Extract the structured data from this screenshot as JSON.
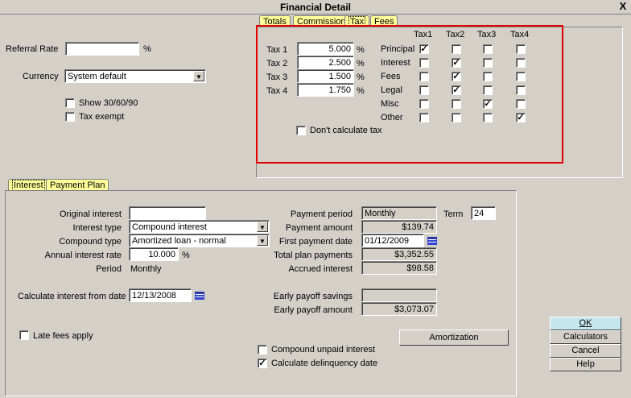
{
  "window": {
    "title": "Financial Detail",
    "close_label": "X"
  },
  "top_tabs": [
    "Totals",
    "Commission",
    "Tax",
    "Fees"
  ],
  "left": {
    "referral_rate_label": "Referral Rate",
    "referral_rate_value": "",
    "referral_rate_unit": "%",
    "currency_label": "Currency",
    "currency_value": "System default",
    "show_30_60_90_label": "Show 30/60/90",
    "show_30_60_90_checked": false,
    "tax_exempt_label": "Tax exempt",
    "tax_exempt_checked": false
  },
  "tax": {
    "rates": [
      {
        "label": "Tax 1",
        "value": "5.000",
        "unit": "%"
      },
      {
        "label": "Tax 2",
        "value": "2.500",
        "unit": "%"
      },
      {
        "label": "Tax 3",
        "value": "1.500",
        "unit": "%"
      },
      {
        "label": "Tax 4",
        "value": "1.750",
        "unit": "%"
      }
    ],
    "columns": [
      "Tax1",
      "Tax2",
      "Tax3",
      "Tax4"
    ],
    "rows": [
      {
        "label": "Principal",
        "checks": [
          true,
          false,
          false,
          false
        ]
      },
      {
        "label": "Interest",
        "checks": [
          false,
          true,
          false,
          false
        ]
      },
      {
        "label": "Fees",
        "checks": [
          false,
          true,
          false,
          false
        ]
      },
      {
        "label": "Legal",
        "checks": [
          false,
          true,
          false,
          false
        ]
      },
      {
        "label": "Misc",
        "checks": [
          false,
          false,
          true,
          false
        ]
      },
      {
        "label": "Other",
        "checks": [
          false,
          false,
          false,
          true
        ]
      }
    ],
    "dont_calculate_label": "Don't calculate tax",
    "dont_calculate_checked": false
  },
  "bottom_tabs": [
    "Interest",
    "Payment Plan"
  ],
  "interest": {
    "original_interest_label": "Original interest",
    "original_interest_value": "",
    "interest_type_label": "Interest type",
    "interest_type_value": "Compound interest",
    "compound_type_label": "Compound type",
    "compound_type_value": "Amortized loan - normal",
    "annual_rate_label": "Annual interest rate",
    "annual_rate_value": "10.000",
    "annual_rate_unit": "%",
    "period_label": "Period",
    "period_value": "Monthly",
    "calc_from_label": "Calculate interest from date",
    "calc_from_value": "12/13/2008",
    "late_fees_label": "Late fees apply",
    "late_fees_checked": false
  },
  "payment": {
    "payment_period_label": "Payment period",
    "payment_period_value": "Monthly",
    "term_label": "Term",
    "term_value": "24",
    "payment_amount_label": "Payment amount",
    "payment_amount_value": "$139.74",
    "first_payment_label": "First payment date",
    "first_payment_value": "01/12/2009",
    "total_plan_label": "Total plan payments",
    "total_plan_value": "$3,352.55",
    "accrued_label": "Accrued interest",
    "accrued_value": "$98.58",
    "early_savings_label": "Early payoff savings",
    "early_savings_value": "",
    "early_amount_label": "Early payoff amount",
    "early_amount_value": "$3,073.07",
    "amortization_label": "Amortization",
    "compound_unpaid_label": "Compound unpaid interest",
    "compound_unpaid_checked": false,
    "calc_delinquency_label": "Calculate delinquency date",
    "calc_delinquency_checked": true
  },
  "buttons": {
    "ok": "OK",
    "calculators": "Calculators",
    "cancel": "Cancel",
    "help": "Help"
  }
}
